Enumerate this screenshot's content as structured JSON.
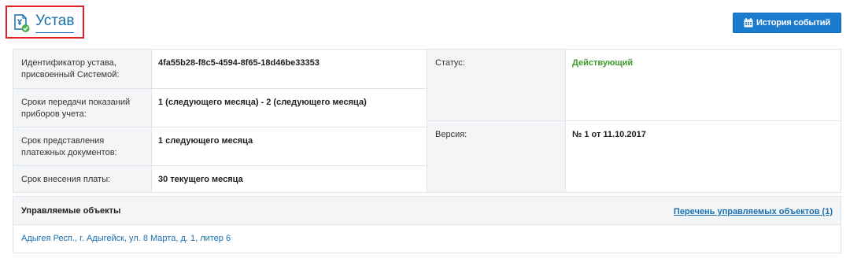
{
  "header": {
    "title": "Устав",
    "title_icon": "document-check-icon",
    "history_button_label": "История событий",
    "history_button_icon": "calendar-icon"
  },
  "details": {
    "charter_id_label": "Идентификатор устава, присвоенный Системой:",
    "charter_id_value": "4fa55b28-f8c5-4594-8f65-18d46be33353",
    "meter_period_label": "Сроки передачи показаний приборов учета:",
    "meter_period_value": "1 (следующего месяца) - 2 (следующего месяца)",
    "payment_docs_label": "Срок представления платежных документов:",
    "payment_docs_value": "1 следующего месяца",
    "payment_due_label": "Срок внесения платы:",
    "payment_due_value": "30 текущего месяца",
    "status_label": "Статус:",
    "status_value": "Действующий",
    "version_label": "Версия:",
    "version_value": "№ 1 от 11.10.2017"
  },
  "managed_objects": {
    "title": "Управляемые объекты",
    "list_link": "Перечень управляемых объектов (1)",
    "items": [
      "Адыгея Респ., г. Адыгейск, ул. 8 Марта, д. 1, литер 6"
    ]
  },
  "colors": {
    "accent": "#1a7bcf",
    "link": "#1b6fae",
    "status_active": "#3f9a2a",
    "highlight_border": "#e11f26"
  }
}
